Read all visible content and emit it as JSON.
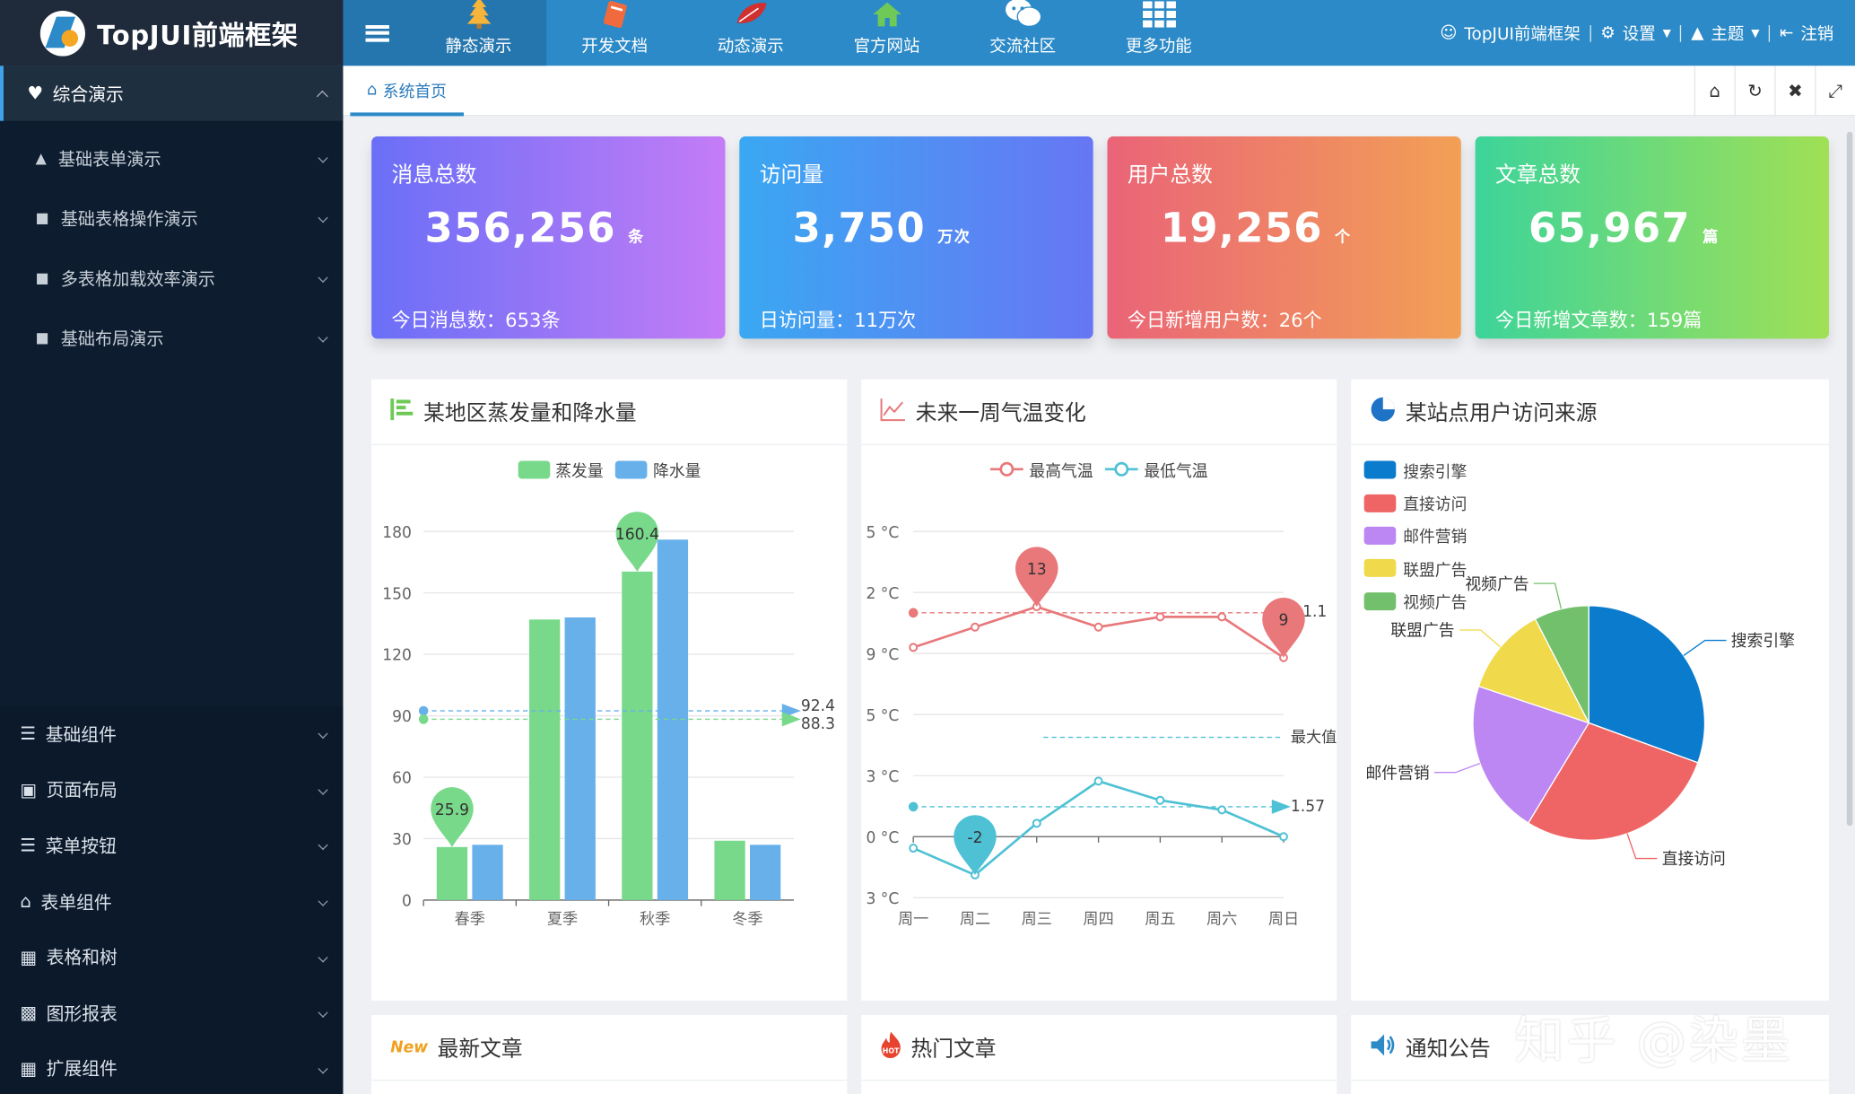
{
  "app": {
    "title": "TopJUI前端框架"
  },
  "nav": {
    "tabs": [
      {
        "label": "静态演示",
        "icon": "tree-icon"
      },
      {
        "label": "开发文档",
        "icon": "book-icon"
      },
      {
        "label": "动态演示",
        "icon": "leaf-icon"
      },
      {
        "label": "官方网站",
        "icon": "home-icon"
      },
      {
        "label": "交流社区",
        "icon": "wechat-icon"
      },
      {
        "label": "更多功能",
        "icon": "grid-icon"
      }
    ]
  },
  "userbar": {
    "user": "TopJUI前端框架",
    "settings": "设置",
    "theme": "主题",
    "logout": "注销"
  },
  "sidebar": {
    "section": "综合演示",
    "items": [
      "基础表单演示",
      "基础表格操作演示",
      "多表格加载效率演示",
      "基础布局演示"
    ],
    "groups": [
      "基础组件",
      "页面布局",
      "菜单按钮",
      "表单组件",
      "表格和树",
      "图形报表",
      "扩展组件"
    ]
  },
  "tabs": {
    "home": "系统首页"
  },
  "cards": [
    {
      "title": "消息总数",
      "value": "356,256",
      "unit": "条",
      "sub": "今日消息数：653条",
      "colors": [
        "#6a6ff7",
        "#c47cf6"
      ]
    },
    {
      "title": "访问量",
      "value": "3,750",
      "unit": "万次",
      "sub": "日访问量：11万次",
      "colors": [
        "#3aa8f2",
        "#6776f4"
      ]
    },
    {
      "title": "用户总数",
      "value": "19,256",
      "unit": "个",
      "sub": "今日新增用户数：26个",
      "colors": [
        "#ea6478",
        "#f2a055"
      ]
    },
    {
      "title": "文章总数",
      "value": "65,967",
      "unit": "篇",
      "sub": "今日新增文章数：159篇",
      "colors": [
        "#3dd49a",
        "#a0e055"
      ]
    }
  ],
  "panels": {
    "bar_title": "某地区蒸发量和降水量",
    "line_title": "未来一周气温变化",
    "pie_title": "某站点用户访问来源",
    "articles_title": "最新文章",
    "hot_title": "热门文章",
    "notice_title": "通知公告"
  },
  "colors": {
    "evap": "#78d98b",
    "rain": "#68b0ea",
    "high": "#e8787a",
    "low": "#4ec1d4",
    "pie": [
      "#0b7bcd",
      "#ef6565",
      "#bc86f3",
      "#f0d94a",
      "#73c06c"
    ]
  },
  "watermark": "知乎 @染墨",
  "chart_data": [
    {
      "type": "bar",
      "categories": [
        "春季",
        "夏季",
        "秋季",
        "冬季"
      ],
      "series": [
        {
          "name": "蒸发量",
          "values": [
            25.9,
            137,
            160.4,
            29
          ]
        },
        {
          "name": "降水量",
          "values": [
            27,
            138,
            176,
            27
          ]
        }
      ],
      "ylim": [
        0,
        180
      ],
      "yticks": [
        0,
        30,
        60,
        90,
        120,
        150,
        180
      ],
      "markPoints": [
        {
          "label": "160.4"
        },
        {
          "label": "25.9"
        }
      ],
      "markLines": [
        {
          "label": "92.4"
        },
        {
          "label": "88.3"
        }
      ]
    },
    {
      "type": "line",
      "categories": [
        "周一",
        "周二",
        "周三",
        "周四",
        "周五",
        "周六",
        "周日"
      ],
      "series": [
        {
          "name": "最高气温",
          "values": [
            11,
            12,
            13,
            12,
            12.5,
            12.5,
            10.5
          ]
        },
        {
          "name": "最低气温",
          "values": [
            -0.6,
            -2,
            0.7,
            2.9,
            1.9,
            1.4,
            0
          ]
        }
      ],
      "ytick_labels": [
        "5 °C",
        "2 °C",
        "9 °C",
        "5 °C",
        "3 °C",
        "0 °C",
        "3 °C"
      ],
      "markPoints": [
        {
          "label": "13"
        },
        {
          "label": "9"
        },
        {
          "label": "-2"
        }
      ],
      "markLines": [
        {
          "label": "1.1"
        },
        {
          "label": "最大值"
        },
        {
          "label": "1.57"
        }
      ]
    },
    {
      "type": "pie",
      "legend": [
        "搜索引擎",
        "直接访问",
        "邮件营销",
        "联盟广告",
        "视频广告"
      ],
      "values": [
        335,
        310,
        234,
        135,
        84
      ],
      "labels": [
        "搜索引擎",
        "直接访问",
        "邮件营销",
        "联盟广告",
        "视频广告"
      ]
    }
  ]
}
